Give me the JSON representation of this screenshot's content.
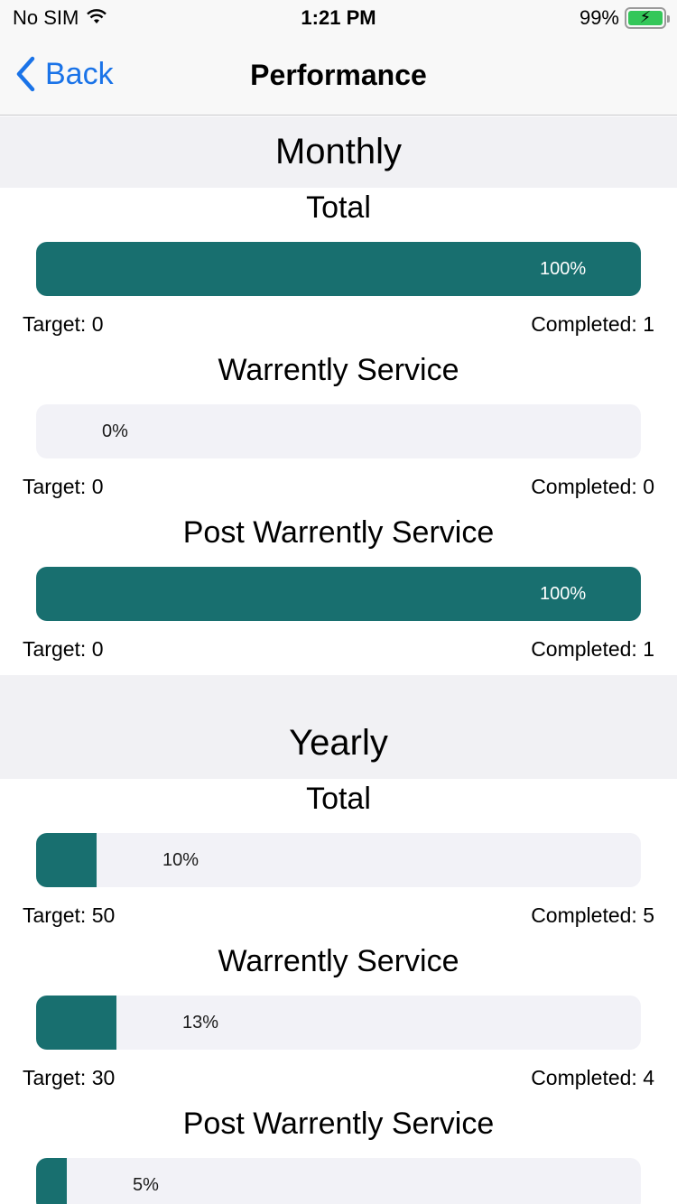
{
  "status_bar": {
    "carrier": "No SIM",
    "time": "1:21 PM",
    "battery": "99%",
    "battery_level": 0.99
  },
  "nav": {
    "back_label": "Back",
    "title": "Performance"
  },
  "sections": [
    {
      "title": "Monthly",
      "metrics": [
        {
          "title": "Total",
          "percent_label": "100%",
          "progress": 1.0,
          "target": "Target: 0",
          "completed": "Completed: 1"
        },
        {
          "title": "Warrently Service",
          "percent_label": "0%",
          "progress": 0.0,
          "target": "Target: 0",
          "completed": "Completed: 0"
        },
        {
          "title": "Post Warrently Service",
          "percent_label": "100%",
          "progress": 1.0,
          "target": "Target: 0",
          "completed": "Completed: 1"
        }
      ]
    },
    {
      "title": "Yearly",
      "metrics": [
        {
          "title": "Total",
          "percent_label": "10%",
          "progress": 0.1,
          "target": "Target: 50",
          "completed": "Completed: 5"
        },
        {
          "title": "Warrently Service",
          "percent_label": "13%",
          "progress": 0.133,
          "target": "Target: 30",
          "completed": "Completed: 4"
        },
        {
          "title": "Post Warrently Service",
          "percent_label": "5%",
          "progress": 0.05
        }
      ]
    }
  ],
  "colors": {
    "fill": "#186f6f",
    "track": "#f2f2f7",
    "accent": "#1a73e8",
    "section_bg": "#f1f1f4"
  }
}
